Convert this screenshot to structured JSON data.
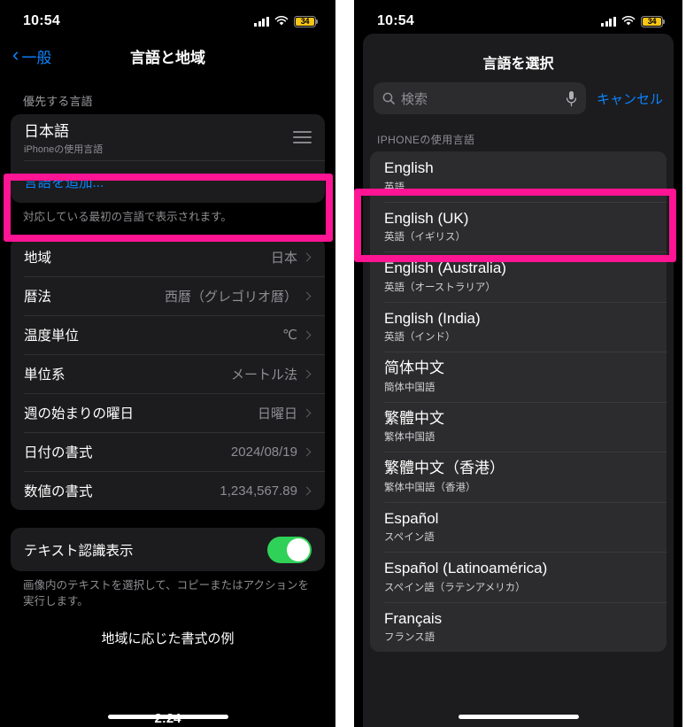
{
  "left_phone": {
    "status_bar": {
      "time": "10:54",
      "battery_percent": "34",
      "cellular_icon": "cellular-bars-icon",
      "wifi_icon": "wifi-icon",
      "battery_icon": "battery-icon"
    },
    "nav": {
      "back_label": "一般",
      "back_icon": "chevron-left-icon",
      "title": "言語と地域"
    },
    "preferred_section": {
      "header": "優先する言語",
      "primary_language": {
        "name": "日本語",
        "sub": "iPhoneの使用言語",
        "reorder_icon": "reorder-handle-icon"
      },
      "add_language_label": "言語を追加...",
      "footer": "対応している最初の言語で表示されます。"
    },
    "region_section": {
      "rows": [
        {
          "label": "地域",
          "value": "日本"
        },
        {
          "label": "暦法",
          "value": "西暦（グレゴリオ暦）"
        },
        {
          "label": "温度単位",
          "value": "℃"
        },
        {
          "label": "単位系",
          "value": "メートル法"
        },
        {
          "label": "週の始まりの曜日",
          "value": "日曜日"
        },
        {
          "label": "日付の書式",
          "value": "2024/08/19"
        },
        {
          "label": "数値の書式",
          "value": "1,234,567.89"
        }
      ]
    },
    "text_recognition": {
      "label": "テキスト認識表示",
      "toggle_state": "on",
      "toggle_color": "#30D158",
      "footer": "画像内のテキストを選択して、コピーまたはアクションを実行します。"
    },
    "example_title": "地域に応じた書式の例",
    "peek_time": "2:24"
  },
  "right_phone": {
    "status_bar": {
      "time": "10:54",
      "battery_percent": "34",
      "cellular_icon": "cellular-bars-icon",
      "wifi_icon": "wifi-icon",
      "battery_icon": "battery-icon"
    },
    "sheet": {
      "title": "言語を選択",
      "search": {
        "placeholder": "検索",
        "value": "",
        "search_icon": "search-icon",
        "mic_icon": "microphone-icon"
      },
      "cancel_label": "キャンセル",
      "group_header": "IPHONEの使用言語",
      "languages": [
        {
          "name": "English",
          "sub": "英語"
        },
        {
          "name": "English (UK)",
          "sub": "英語（イギリス）"
        },
        {
          "name": "English (Australia)",
          "sub": "英語（オーストラリア）"
        },
        {
          "name": "English (India)",
          "sub": "英語（インド）"
        },
        {
          "name": "简体中文",
          "sub": "簡体中国語"
        },
        {
          "name": "繁體中文",
          "sub": "繁体中国語"
        },
        {
          "name": "繁體中文（香港）",
          "sub": "繁体中国語（香港）"
        },
        {
          "name": "Español",
          "sub": "スペイン語"
        },
        {
          "name": "Español (Latinoamérica)",
          "sub": "スペイン語（ラテンアメリカ）"
        },
        {
          "name": "Français",
          "sub": "フランス語"
        }
      ]
    }
  },
  "annotations": {
    "highlight_color": "#FF1493",
    "left_target": "言語を追加...",
    "right_target": "English"
  }
}
